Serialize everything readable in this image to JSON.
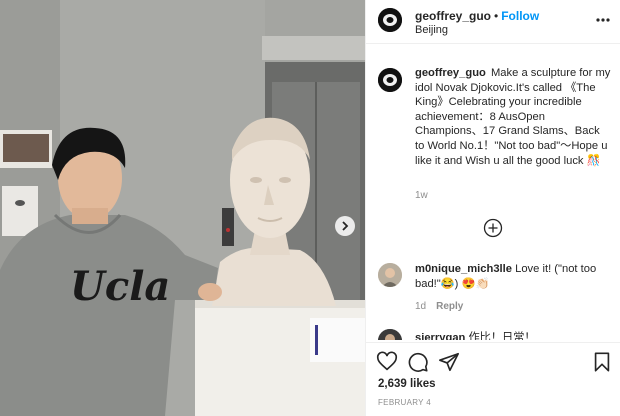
{
  "post": {
    "author": "geoffrey_guo",
    "separator": "•",
    "follow_label": "Follow",
    "location": "Beijing",
    "caption_text": "Make a sculpture for my idol Novak Djokovic.It's called 《The King》Celebrating your incredible achievement：8 AusOpen Champions、17 Grand Slams、Back to World No.1！\"Not too bad\"～Hope u like it and Wish u all the good luck 🎊",
    "caption_time": "1w",
    "likes": "2,639 likes",
    "date": "FEBRUARY 4"
  },
  "photo": {
    "sweatshirt_text": "Ucla"
  },
  "comments": [
    {
      "user": "m0nique_mich3lle",
      "text": "Love it! (\"not too bad!\"😂) 😍👏🏻",
      "time": "1d",
      "reply_label": "Reply"
    },
    {
      "user": "sierrygan",
      "text": "作比！日常！"
    }
  ],
  "icons": {
    "more": "more-options-icon",
    "next": "chevron-right-icon",
    "load_more": "plus-circle-icon",
    "like": "heart-icon",
    "comment": "comment-icon",
    "share": "share-icon",
    "save": "bookmark-icon"
  },
  "colors": {
    "accent": "#0095f6",
    "muted": "#8e8e8e",
    "text": "#262626"
  }
}
